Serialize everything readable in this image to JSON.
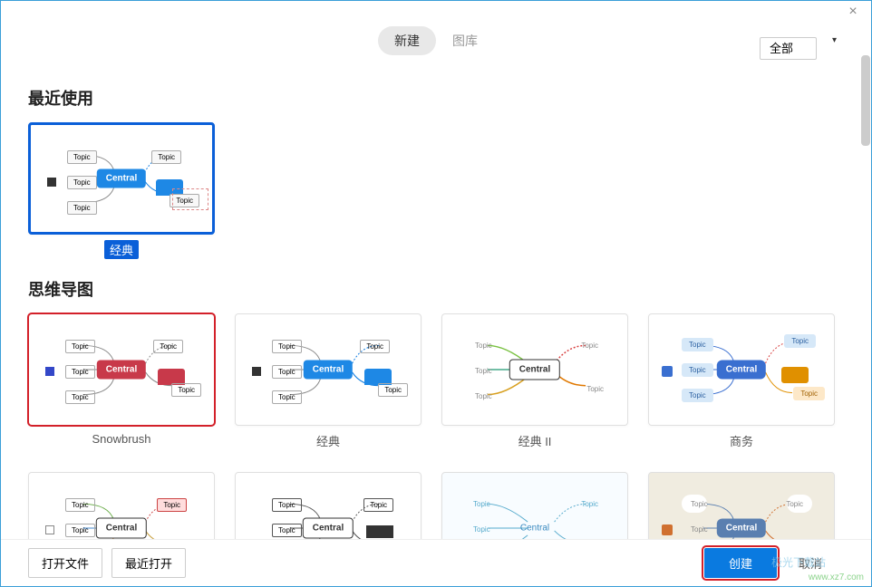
{
  "window": {
    "close": "×"
  },
  "header": {
    "tabs": {
      "new": "新建",
      "library": "图库"
    },
    "filter": {
      "value": "全部"
    }
  },
  "sections": {
    "recent": {
      "title": "最近使用",
      "items": [
        {
          "label": "经典",
          "central": "Central",
          "topic": "Topic"
        }
      ]
    },
    "mindmap": {
      "title": "思维导图",
      "items": [
        {
          "label": "Snowbrush",
          "central": "Central",
          "topic": "Topic"
        },
        {
          "label": "经典",
          "central": "Central",
          "topic": "Topic"
        },
        {
          "label": "经典 II",
          "central": "Central",
          "topic": "Topic"
        },
        {
          "label": "商务",
          "central": "Central",
          "topic": "Topic"
        },
        {
          "label": "",
          "central": "Central",
          "topic": "Topic"
        },
        {
          "label": "",
          "central": "Central",
          "topic": "Topic"
        },
        {
          "label": "",
          "central": "Central",
          "topic": "Topic"
        },
        {
          "label": "",
          "central": "Central",
          "topic": "Topic"
        }
      ]
    }
  },
  "footer": {
    "open_file": "打开文件",
    "recent_open": "最近打开",
    "create": "创建",
    "cancel": "取消"
  },
  "watermark": {
    "site": "www.xz7.com",
    "name": "极光下载站"
  },
  "colors": {
    "primary": "#0a7ae0",
    "accent_red": "#d32029",
    "accent_blue": "#0a5fd8",
    "snowbrush_accent": "#c8394a",
    "classic_ii_green": "#7ac142"
  }
}
